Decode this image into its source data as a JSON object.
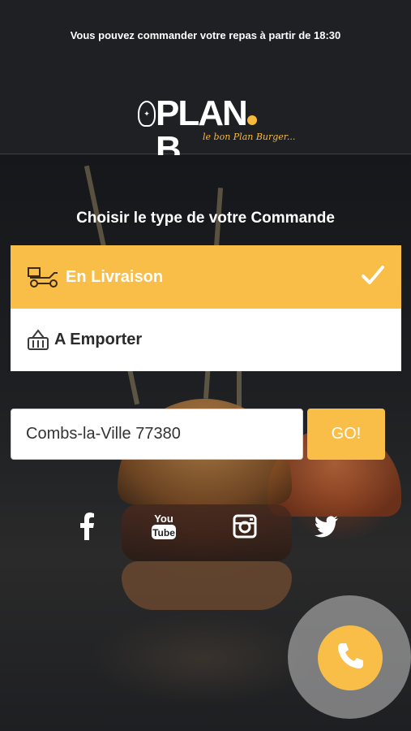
{
  "header": {
    "notice": "Vous pouvez commander votre repas à partir de 18:30",
    "logo": {
      "name": "PLAN.B",
      "tagline": "le bon Plan Burger..."
    }
  },
  "order": {
    "heading": "Choisir le type de votre Commande",
    "options": [
      {
        "label": "En Livraison",
        "icon": "delivery-scooter-icon",
        "selected": true
      },
      {
        "label": "A Emporter",
        "icon": "basket-icon",
        "selected": false
      }
    ]
  },
  "address": {
    "value": "Combs-la-Ville 77380",
    "go_label": "GO!"
  },
  "social": [
    "facebook-icon",
    "youtube-icon",
    "instagram-icon",
    "twitter-icon"
  ],
  "call": {
    "icon": "phone-icon"
  },
  "colors": {
    "accent": "#f8be48",
    "background": "#1f2024"
  }
}
